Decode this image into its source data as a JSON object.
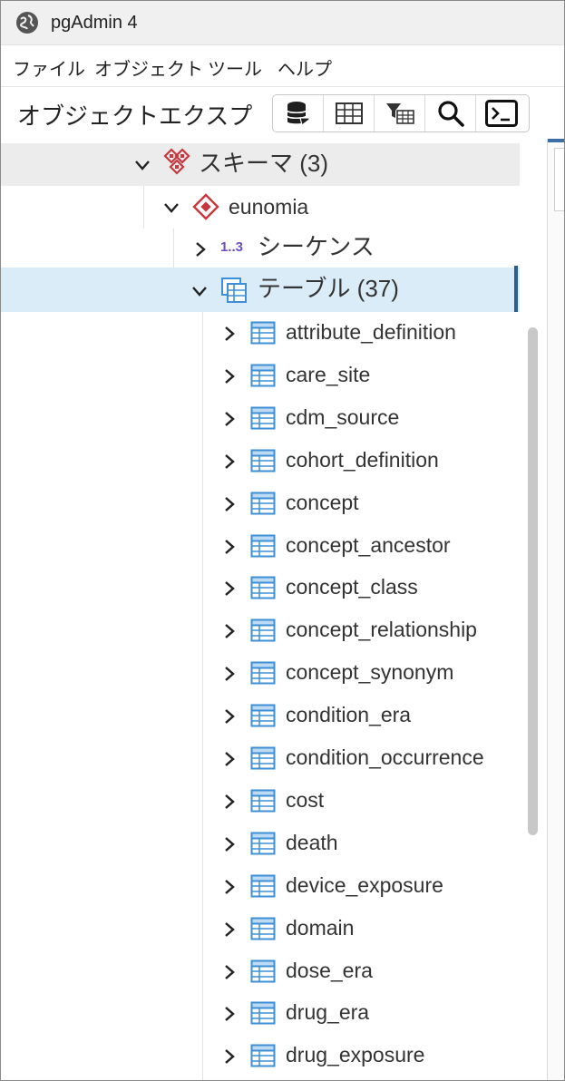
{
  "window": {
    "title": "pgAdmin 4",
    "icon": "pgadmin-globe-icon"
  },
  "menu": {
    "items": [
      "ファイル",
      "オブジェクト",
      "ツール",
      "ヘルプ"
    ]
  },
  "explorer": {
    "title": "オブジェクトエクスプ",
    "toolbar": [
      "database-query-icon",
      "table-grid-icon",
      "filtered-rows-icon",
      "search-icon",
      "terminal-icon"
    ]
  },
  "tree": {
    "schemas": {
      "label": "スキーマ (3)",
      "icon": "schemas-icon",
      "expanded": true
    },
    "schema": {
      "label": "eunomia",
      "icon": "schema-icon",
      "expanded": true
    },
    "sequences": {
      "label": "シーケンス",
      "icon_text": "1..3",
      "expanded": false
    },
    "tables": {
      "label": "テーブル (37)",
      "icon": "tables-icon",
      "expanded": true,
      "selected": true
    },
    "table_items": [
      "attribute_definition",
      "care_site",
      "cdm_source",
      "cohort_definition",
      "concept",
      "concept_ancestor",
      "concept_class",
      "concept_relationship",
      "concept_synonym",
      "condition_era",
      "condition_occurrence",
      "cost",
      "death",
      "device_exposure",
      "domain",
      "dose_era",
      "drug_era",
      "drug_exposure"
    ]
  },
  "colors": {
    "selection": "#d9ecf8",
    "accent": "#2a5d8c",
    "schema_red": "#c9363e",
    "table_blue": "#3e8fd6",
    "sequence_purple": "#6c4fbf"
  }
}
